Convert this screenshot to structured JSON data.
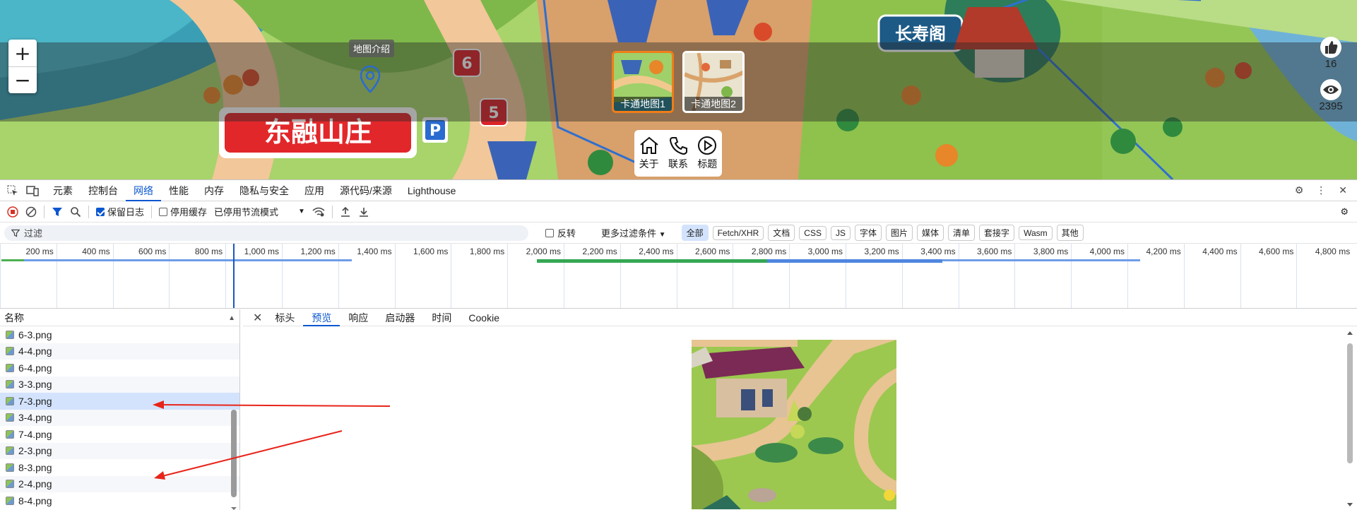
{
  "map": {
    "zoom_in": "+",
    "zoom_out": "−",
    "tooltip": "地图介绍",
    "thumbnails": [
      {
        "label": "卡通地图1"
      },
      {
        "label": "卡通地图2"
      }
    ],
    "nav": [
      {
        "label": "关于",
        "icon": "home-icon"
      },
      {
        "label": "联系",
        "icon": "phone-icon"
      },
      {
        "label": "标题",
        "icon": "play-icon"
      }
    ],
    "stats": {
      "likes": "16",
      "views": "2395"
    },
    "signs": {
      "main_sign": "东融山庄",
      "top_sign": "长寿阁",
      "parking": "P",
      "marker_6": "6",
      "marker_5": "5"
    }
  },
  "devtools": {
    "tabs": [
      "元素",
      "控制台",
      "网络",
      "性能",
      "内存",
      "隐私与安全",
      "应用",
      "源代码/来源",
      "Lighthouse"
    ],
    "active_tab": "网络",
    "toolbar": {
      "preserve_log": "保留日志",
      "disable_cache": "停用缓存",
      "throttle": "已停用节流模式"
    },
    "filter": {
      "placeholder": "过滤",
      "invert": "反转",
      "more": "更多过滤条件",
      "chips": [
        "全部",
        "Fetch/XHR",
        "文档",
        "CSS",
        "JS",
        "字体",
        "图片",
        "媒体",
        "清单",
        "套接字",
        "Wasm",
        "其他"
      ]
    },
    "timeline_ticks": [
      "200 ms",
      "400 ms",
      "600 ms",
      "800 ms",
      "1,000 ms",
      "1,200 ms",
      "1,400 ms",
      "1,600 ms",
      "1,800 ms",
      "2,000 ms",
      "2,200 ms",
      "2,400 ms",
      "2,600 ms",
      "2,800 ms",
      "3,000 ms",
      "3,200 ms",
      "3,400 ms",
      "3,600 ms",
      "3,800 ms",
      "4,000 ms",
      "4,200 ms",
      "4,400 ms",
      "4,600 ms",
      "4,800 ms"
    ],
    "requests": {
      "header": "名称",
      "items": [
        "6-3.png",
        "4-4.png",
        "6-4.png",
        "3-3.png",
        "7-3.png",
        "3-4.png",
        "7-4.png",
        "2-3.png",
        "8-3.png",
        "2-4.png",
        "8-4.png"
      ],
      "selected": "7-3.png"
    },
    "detail_tabs": [
      "标头",
      "预览",
      "响应",
      "启动器",
      "时间",
      "Cookie"
    ],
    "active_detail_tab": "预览"
  },
  "colors": {
    "accent": "#0b57d0",
    "selected_row": "#d3e3fd",
    "arrow": "#e8241a"
  }
}
